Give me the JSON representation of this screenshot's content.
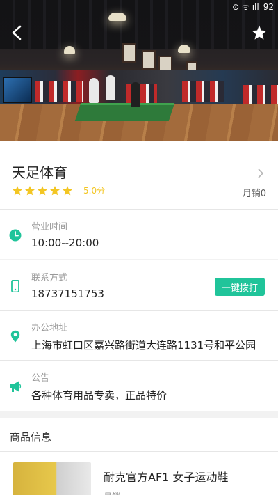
{
  "status_bar": {
    "battery": "92"
  },
  "shop": {
    "name": "天足体育",
    "rating": 5.0,
    "rating_text": "5.0分",
    "monthly_sales": "月销0",
    "rating_color": "#f3c623"
  },
  "info": [
    {
      "label": "营业时间",
      "value": "10:00--20:00",
      "icon": "clock-icon"
    },
    {
      "label": "联系方式",
      "value": "18737151753",
      "icon": "phone-icon"
    },
    {
      "label": "办公地址",
      "value": "上海市虹口区嘉兴路街道大连路1131号和平公园",
      "icon": "location-pin-icon"
    },
    {
      "label": "公告",
      "value": "各种体育用品专卖，正品特价",
      "icon": "megaphone-icon"
    }
  ],
  "call_button": {
    "label": "一键拨打",
    "color": "#20c49a"
  },
  "products": {
    "title": "商品信息",
    "items": [
      {
        "name": "耐克官方AF1  女子运动鞋",
        "sub": "月销"
      }
    ]
  },
  "accent_color": "#20c49a"
}
